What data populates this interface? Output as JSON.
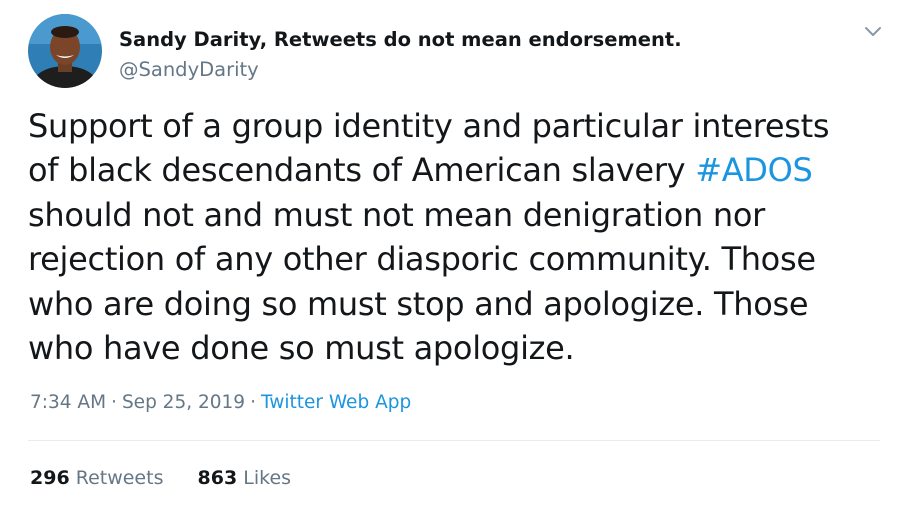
{
  "user": {
    "display_name": "Sandy Darity, Retweets do not mean endorsement.",
    "handle": "@SandyDarity",
    "avatar_icon": "avatar-photo"
  },
  "menu": {
    "icon": "chevron-down-icon"
  },
  "tweet": {
    "lines": [
      "Support of a group identity and particular interests",
      "of black descendants of American slavery ",
      "should not and must not mean denigration nor",
      "rejection of any other diasporic community. Those",
      "who are doing so must stop and apologize. Those",
      "who have done so must apologize."
    ],
    "hashtag": "#ADOS"
  },
  "meta": {
    "time": "7:34 AM",
    "separator": "·",
    "date": "Sep 25, 2019",
    "source": "Twitter Web App"
  },
  "stats": {
    "retweets_count": "296",
    "retweets_label": "Retweets",
    "likes_count": "863",
    "likes_label": "Likes"
  },
  "colors": {
    "link": "#1b95e0",
    "secondary": "#657786",
    "primary": "#14171a",
    "divider": "#e6ecf0"
  }
}
